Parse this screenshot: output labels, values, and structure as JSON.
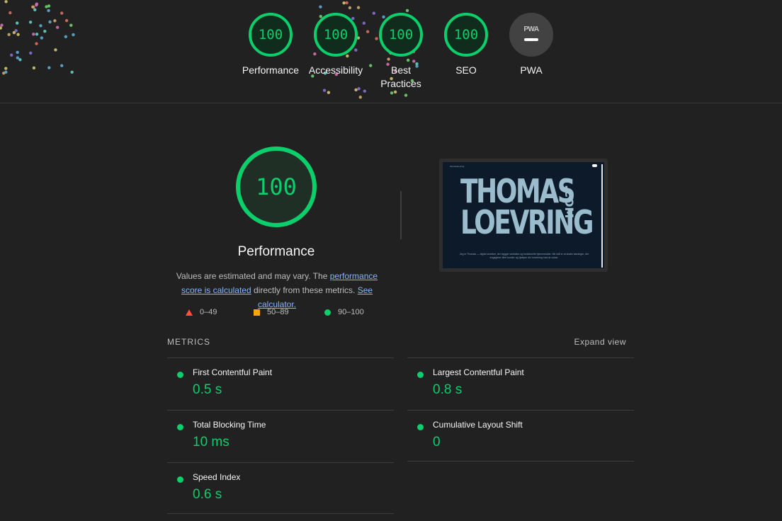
{
  "header": {
    "gauges": [
      {
        "name": "performance",
        "score": "100",
        "label": "Performance"
      },
      {
        "name": "accessibility",
        "score": "100",
        "label": "Accessibility"
      },
      {
        "name": "best-practices",
        "score": "100",
        "label": "Best Practices"
      },
      {
        "name": "seo",
        "score": "100",
        "label": "SEO"
      },
      {
        "name": "pwa",
        "badge": "PWA",
        "label": "PWA"
      }
    ]
  },
  "performance": {
    "score": "100",
    "title": "Performance",
    "desc_prefix": "Values are estimated and may vary. The ",
    "link_score": "performance score is calculated",
    "desc_middle": " directly from these metrics. ",
    "link_calc": "See calculator.",
    "legend": [
      {
        "icon": "triangle-fail",
        "range": "0–49",
        "color": "#ff4e42"
      },
      {
        "icon": "square-average",
        "range": "50–89",
        "color": "#ffa400"
      },
      {
        "icon": "circle-pass",
        "range": "90–100",
        "color": "#0cce6b"
      }
    ]
  },
  "screenshot": {
    "nav_text": "thomasloevring",
    "title_line1": "THOMAS",
    "title_line2": "LOEVRING",
    "title_suffix": ".COM",
    "description": "Jeg er Thomas — digital snedker, der bygger websites og funktionelle hjemmesider. Mit mål er at skabe løsninger, der engagerer dine kunder og hjælper din forretning med at vokse."
  },
  "metrics": {
    "title": "METRICS",
    "expand_label": "Expand view",
    "items": [
      {
        "label": "First Contentful Paint",
        "value": "0.5 s"
      },
      {
        "label": "Largest Contentful Paint",
        "value": "0.8 s"
      },
      {
        "label": "Total Blocking Time",
        "value": "10 ms"
      },
      {
        "label": "Cumulative Layout Shift",
        "value": "0"
      },
      {
        "label": "Speed Index",
        "value": "0.6 s"
      }
    ]
  },
  "colors": {
    "pass": "#0cce6b",
    "average": "#ffa400",
    "fail": "#ff4e42",
    "background": "#212121",
    "link": "#8ab4f8"
  }
}
